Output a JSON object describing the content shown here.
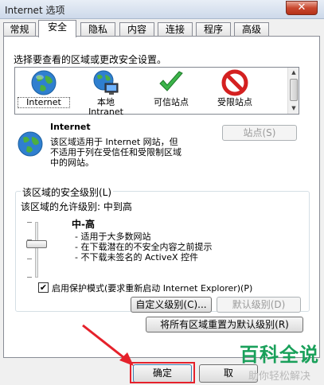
{
  "window": {
    "title": "Internet 选项",
    "close_glyph": "✕"
  },
  "tabs": [
    {
      "label": "常规"
    },
    {
      "label": "安全"
    },
    {
      "label": "隐私"
    },
    {
      "label": "内容"
    },
    {
      "label": "连接"
    },
    {
      "label": "程序"
    },
    {
      "label": "高级"
    }
  ],
  "active_tab": "安全",
  "security": {
    "instruction": "选择要查看的区域或更改安全设置。",
    "zones": [
      {
        "label": "Internet",
        "icon": "globe-icon"
      },
      {
        "label": "本地\nIntranet",
        "icon": "intranet-icon"
      },
      {
        "label": "可信站点",
        "icon": "checkmark-icon"
      },
      {
        "label": "受限站点",
        "icon": "restricted-icon"
      }
    ],
    "selected_zone_title": "Internet",
    "zone_description": "该区域适用于 Internet 网站，但\n不适用于列在受信任和受限制区域\n中的网站。",
    "sites_button": "站点(S)",
    "level_group_title": "该区域的安全级别(L)",
    "allowed_levels": "该区域的允许级别: 中到高",
    "level_name": "中-高",
    "level_bullets": [
      "- 适用于大多数网站",
      "- 在下载潜在的不安全内容之前提示",
      "- 不下载未签名的 ActiveX 控件"
    ],
    "protected_mode_label": "启用保护模式(要求重新启动 Internet Explorer)(P)",
    "protected_mode_checked": true,
    "checkmark_glyph": "✔",
    "custom_level_button": "自定义级别(C)...",
    "default_level_button": "默认级别(D)",
    "reset_all_button": "将所有区域重置为默认级别(R)"
  },
  "footer": {
    "ok_button": "确定",
    "cancel_button_partial": "取"
  },
  "watermark": {
    "main": "百科全说",
    "sub": "助你轻松解决"
  },
  "colors": {
    "highlight": "#e5212b",
    "watermark_green": "#19a05a"
  }
}
